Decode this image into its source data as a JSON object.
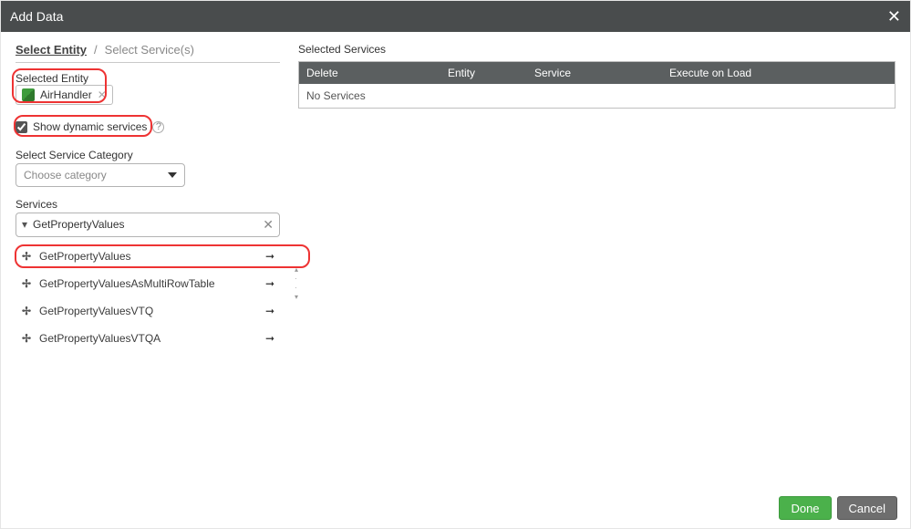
{
  "titlebar": {
    "title": "Add Data"
  },
  "breadcrumb": {
    "step1": "Select Entity",
    "sep": "/",
    "step2": "Select Service(s)"
  },
  "labels": {
    "selected_entity": "Selected Entity",
    "show_dynamic": "Show dynamic services",
    "select_category": "Select Service Category",
    "services": "Services",
    "selected_services": "Selected Services"
  },
  "entity": {
    "name": "AirHandler"
  },
  "show_dynamic_checked": true,
  "category": {
    "placeholder": "Choose category"
  },
  "filter": {
    "value": "GetPropertyValues"
  },
  "services": [
    {
      "name": "GetPropertyValues"
    },
    {
      "name": "GetPropertyValuesAsMultiRowTable"
    },
    {
      "name": "GetPropertyValuesVTQ"
    },
    {
      "name": "GetPropertyValuesVTQA"
    }
  ],
  "table": {
    "headers": {
      "delete": "Delete",
      "entity": "Entity",
      "service": "Service",
      "execute": "Execute on Load"
    },
    "empty": "No Services"
  },
  "footer": {
    "done": "Done",
    "cancel": "Cancel"
  }
}
